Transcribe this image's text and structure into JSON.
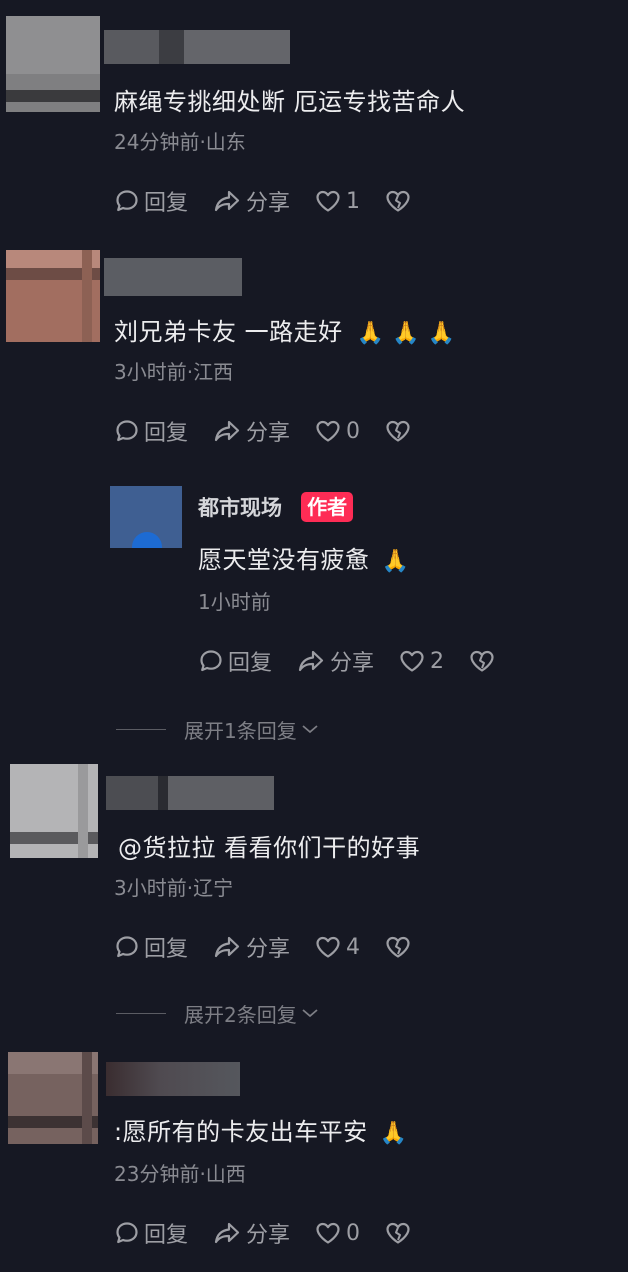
{
  "comments": [
    {
      "text": "麻绳专挑细处断 厄运专找苦命人",
      "meta": "24分钟前·山东",
      "reply_label": "回复",
      "share_label": "分享",
      "likes": "1",
      "avatar_colors": [
        "#8a8a8c",
        "#5e5e60",
        "#2a2a2d"
      ]
    },
    {
      "text": "刘兄弟卡友 一路走好",
      "emoji": "🙏  🙏  🙏",
      "meta": "3小时前·江西",
      "reply_label": "回复",
      "share_label": "分享",
      "likes": "0",
      "avatar_colors": [
        "#a87567",
        "#7c5149",
        "#3b2c2b"
      ],
      "reply": {
        "author": "都市现场",
        "badge": "作者",
        "text": "愿天堂没有疲惫",
        "emoji": "🙏",
        "meta": "1小时前",
        "reply_label": "回复",
        "share_label": "分享",
        "likes": "2"
      },
      "expand_label": "展开1条回复"
    },
    {
      "text": "@货拉拉  看看你们干的好事",
      "meta": "3小时前·辽宁",
      "reply_label": "回复",
      "share_label": "分享",
      "likes": "4",
      "avatar_colors": [
        "#b7b7b9",
        "#8c8c8e",
        "#4a4a4d"
      ],
      "expand_label": "展开2条回复"
    },
    {
      "text": ":愿所有的卡友出车平安",
      "emoji": "🙏",
      "meta": "23分钟前·山西",
      "reply_label": "回复",
      "share_label": "分享",
      "likes": "0",
      "avatar_colors": [
        "#7a6563",
        "#5a4a49",
        "#2e2829"
      ]
    }
  ],
  "colors": {
    "background": "#161823",
    "author_badge": "#fe2c55",
    "text": "#ececee",
    "meta": "#8a8b92"
  },
  "icons": [
    "reply-bubble-icon",
    "share-arrow-icon",
    "heart-icon",
    "broken-heart-icon",
    "chevron-down-icon"
  ]
}
